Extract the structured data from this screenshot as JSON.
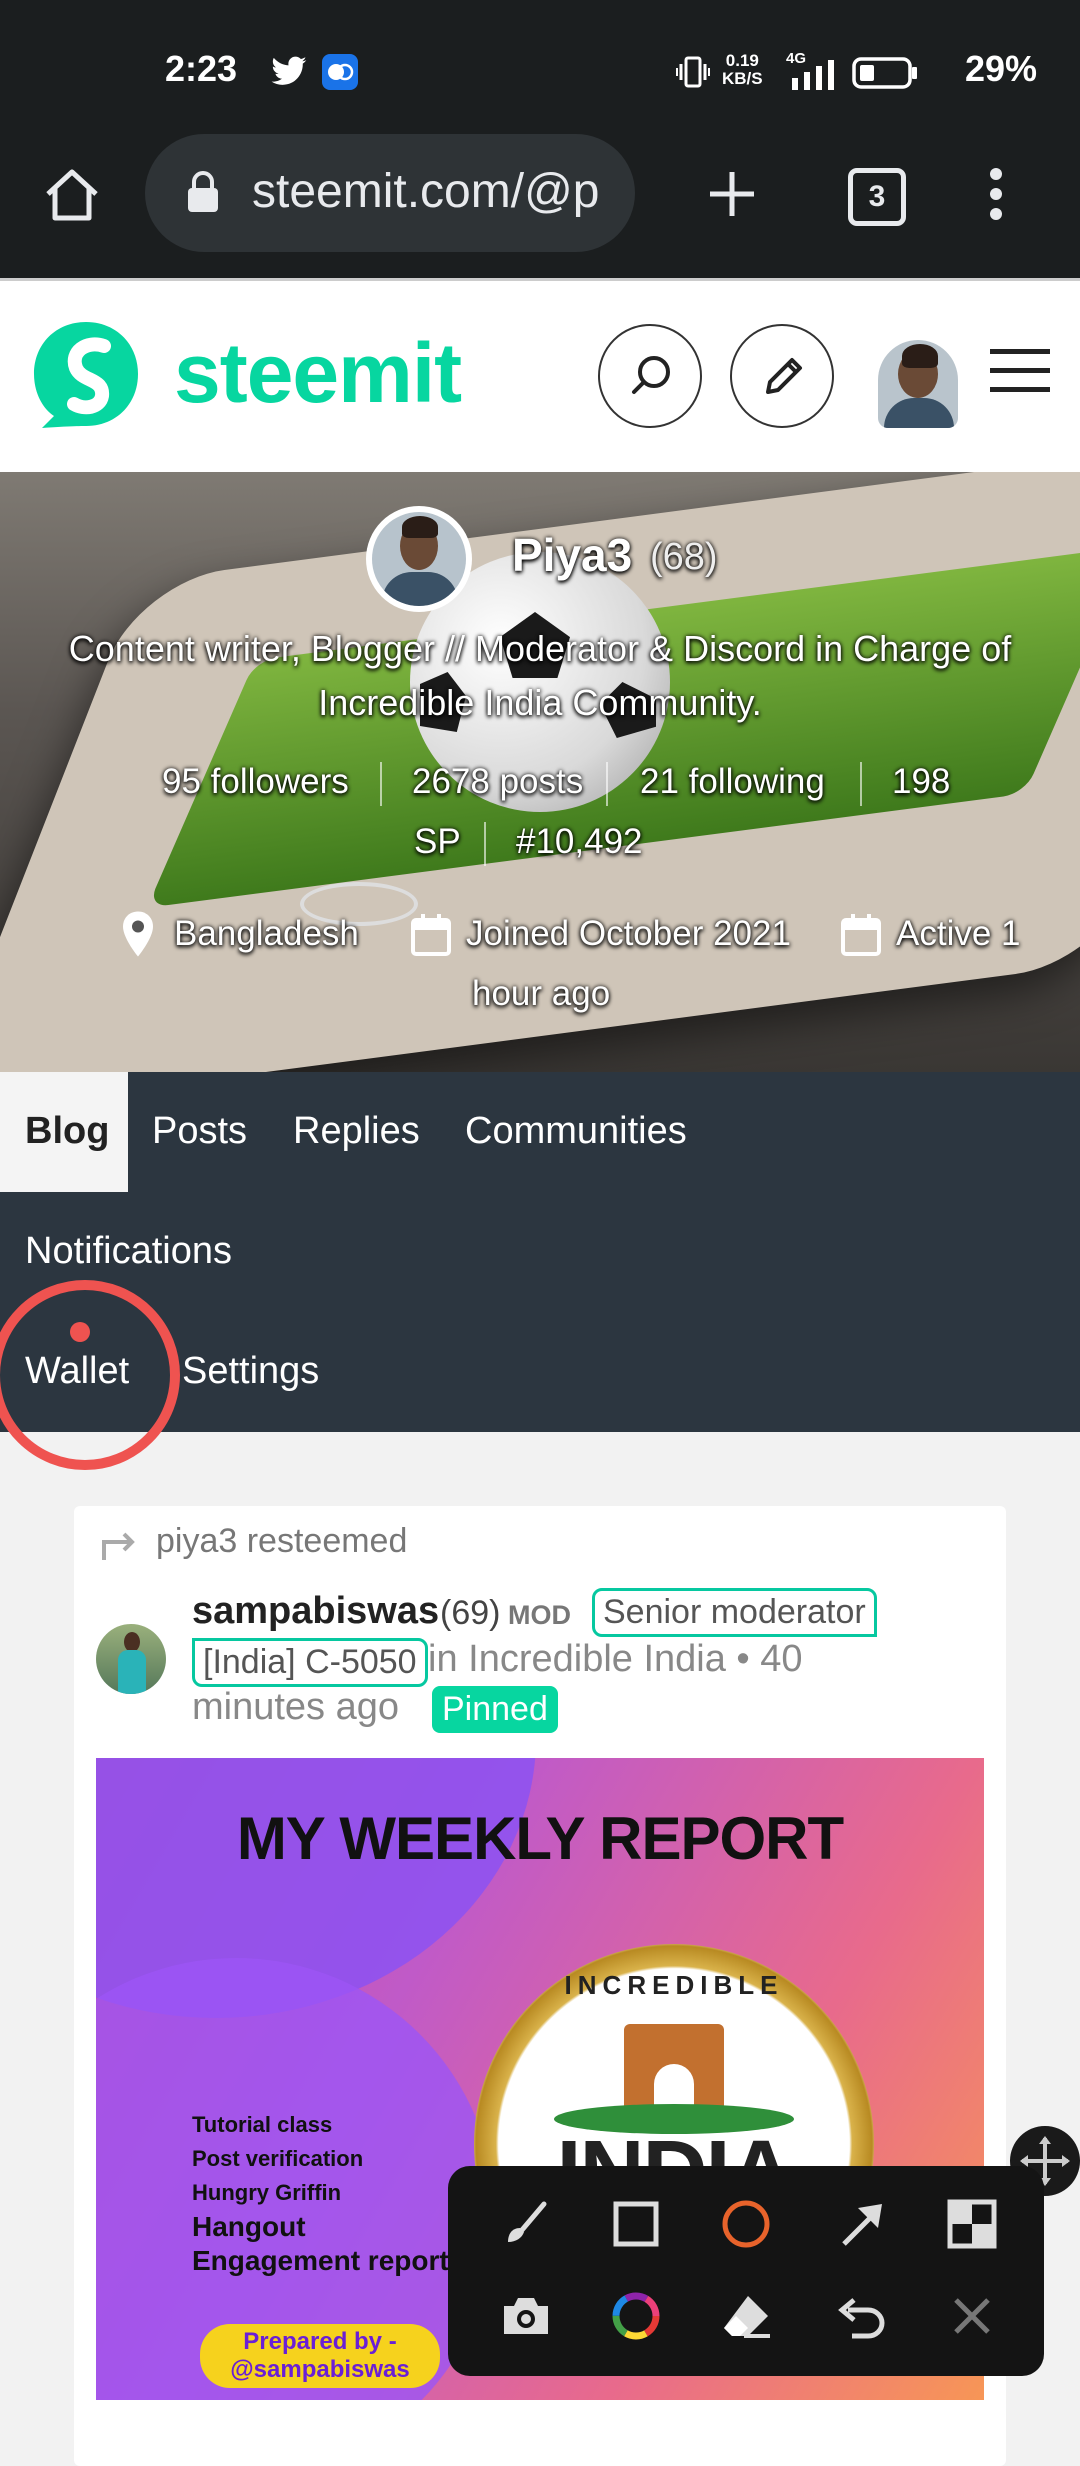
{
  "status_bar": {
    "time": "2:23",
    "net_speed_value": "0.19",
    "net_speed_unit": "KB/S",
    "network": "4G",
    "battery_pct": "29%"
  },
  "browser": {
    "url": "steemit.com/@p",
    "tab_count": "3"
  },
  "site": {
    "brand": "steemit",
    "accent": "#07d6a0"
  },
  "profile": {
    "name": "Piya3",
    "reputation": "(68)",
    "about_line1": "Content writer, Blogger // Moderator & Discord in Charge of",
    "about_line2": "Incredible India Community.",
    "followers": "95 followers",
    "posts": "2678 posts",
    "following": "21 following",
    "sp_a": "198",
    "sp_b": "SP",
    "rank": "#10,492",
    "location": "Bangladesh",
    "joined": "Joined October 2021",
    "active_a": "Active 1",
    "active_b": "hour ago"
  },
  "nav": {
    "blog": "Blog",
    "posts": "Posts",
    "replies": "Replies",
    "communities": "Communities",
    "notifications": "Notifications",
    "wallet": "Wallet",
    "settings": "Settings"
  },
  "post": {
    "resteem_by": "piya3 resteemed",
    "author": "sampabiswas",
    "author_rep": "(69)",
    "mod_tag": "MOD",
    "role_a": "Senior moderator",
    "role_b": "[India] C-5050",
    "in_community": "in Incredible India • 40",
    "time": "minutes ago",
    "pinned": "Pinned",
    "image": {
      "title": "MY WEEKLY REPORT",
      "items": [
        "Tutorial class",
        "Post verification",
        "Hungry Griffin",
        "Hangout",
        "Engagement report"
      ],
      "prepared_a": "Prepared by -",
      "prepared_b": "@sampabiswas",
      "logo_top": "INCREDIBLE",
      "logo_main": "INDIA"
    }
  },
  "annotation_toolbar": {
    "tools": [
      "brush-icon",
      "rectangle-icon",
      "circle-icon",
      "arrow-icon",
      "mosaic-icon",
      "camera-icon",
      "color-wheel-icon",
      "eraser-icon",
      "undo-icon",
      "close-icon"
    ],
    "active_color": "#e8632b"
  }
}
